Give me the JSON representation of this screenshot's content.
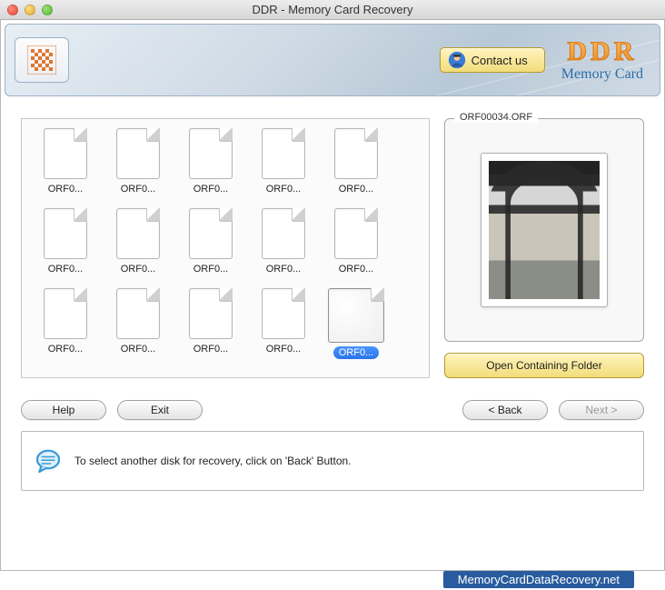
{
  "window": {
    "title": "DDR - Memory Card Recovery"
  },
  "header": {
    "contact_label": "Contact us",
    "brand_top": "DDR",
    "brand_sub": "Memory Card"
  },
  "files": [
    {
      "label": "ORF0...",
      "selected": false
    },
    {
      "label": "ORF0...",
      "selected": false
    },
    {
      "label": "ORF0...",
      "selected": false
    },
    {
      "label": "ORF0...",
      "selected": false
    },
    {
      "label": "ORF0...",
      "selected": false
    },
    {
      "label": "ORF0...",
      "selected": false
    },
    {
      "label": "ORF0...",
      "selected": false
    },
    {
      "label": "ORF0...",
      "selected": false
    },
    {
      "label": "ORF0...",
      "selected": false
    },
    {
      "label": "ORF0...",
      "selected": false
    },
    {
      "label": "ORF0...",
      "selected": false
    },
    {
      "label": "ORF0...",
      "selected": false
    },
    {
      "label": "ORF0...",
      "selected": false
    },
    {
      "label": "ORF0...",
      "selected": false
    },
    {
      "label": "ORF0...",
      "selected": true
    }
  ],
  "preview": {
    "filename": "ORF00034.ORF",
    "open_folder_label": "Open Containing Folder"
  },
  "buttons": {
    "help": "Help",
    "exit": "Exit",
    "back": "< Back",
    "next": "Next >"
  },
  "hint": {
    "text": "To select another disk for recovery, click on 'Back' Button."
  },
  "footer": {
    "link": "MemoryCardDataRecovery.net"
  }
}
